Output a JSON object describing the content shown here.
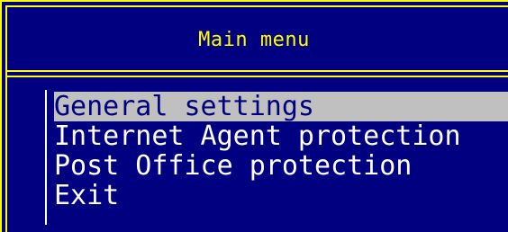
{
  "window": {
    "title": "Main menu",
    "frame_color": "#ffff00",
    "background_color": "#000080"
  },
  "menu": {
    "items": [
      {
        "label": "General settings",
        "selected": true
      },
      {
        "label": "Internet Agent protection",
        "selected": false
      },
      {
        "label": "Post Office protection",
        "selected": false
      },
      {
        "label": "Exit",
        "selected": false
      }
    ],
    "selected_background": "#c0c0c0",
    "selected_text_color": "#000080",
    "text_color": "#ffffff"
  }
}
